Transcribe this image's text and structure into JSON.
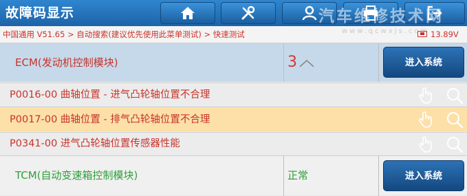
{
  "header": {
    "title": "故障码显示",
    "buttons": [
      {
        "icon": "home-icon"
      },
      {
        "icon": "tools-icon"
      },
      {
        "icon": "user-icon"
      },
      {
        "icon": "print-icon"
      },
      {
        "icon": "exit-icon"
      }
    ],
    "watermark": "汽车维修技术网"
  },
  "breadcrumb": {
    "path": "中国通用 V51.65 > 自动搜索(建议优先使用此菜单测试) > 快速测试",
    "watermark": "www.qcwxjs.com",
    "voltage": "13.89V"
  },
  "modules": [
    {
      "name": "ECM(发动机控制模块)",
      "status": "3",
      "status_color": "#d9352c",
      "enter_label": "进入系统",
      "name_color": "#c8332b",
      "dtcs": [
        {
          "text": "P0016-00 曲轴位置 - 进气凸轮轴位置不合理",
          "highlighted": false
        },
        {
          "text": "P0017-00 曲轴位置 - 排气凸轮轴位置不合理",
          "highlighted": true
        },
        {
          "text": "P0341-00 进气凸轮轴位置传感器性能",
          "highlighted": false
        }
      ]
    },
    {
      "name": "TCM(自动变速箱控制模块)",
      "status": "正常",
      "status_color": "#2e9e3a",
      "enter_label": "进入系统",
      "name_color": "#2e9e3a"
    }
  ],
  "colors": {
    "header_blue": "#1d63a8",
    "selected_row": "#c6d9ea",
    "highlight_row": "#fce0a8",
    "dtc_text": "#c8332b"
  }
}
